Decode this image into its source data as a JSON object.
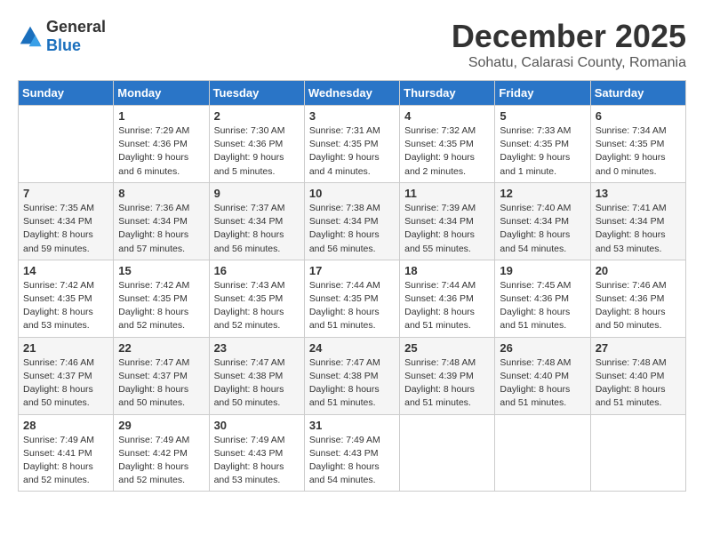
{
  "logo": {
    "general": "General",
    "blue": "Blue"
  },
  "title": {
    "month": "December 2025",
    "subtitle": "Sohatu, Calarasi County, Romania"
  },
  "weekdays": [
    "Sunday",
    "Monday",
    "Tuesday",
    "Wednesday",
    "Thursday",
    "Friday",
    "Saturday"
  ],
  "weeks": [
    [
      {
        "day": null
      },
      {
        "day": 1,
        "sunrise": "7:29 AM",
        "sunset": "4:36 PM",
        "daylight": "9 hours and 6 minutes."
      },
      {
        "day": 2,
        "sunrise": "7:30 AM",
        "sunset": "4:36 PM",
        "daylight": "9 hours and 5 minutes."
      },
      {
        "day": 3,
        "sunrise": "7:31 AM",
        "sunset": "4:35 PM",
        "daylight": "9 hours and 4 minutes."
      },
      {
        "day": 4,
        "sunrise": "7:32 AM",
        "sunset": "4:35 PM",
        "daylight": "9 hours and 2 minutes."
      },
      {
        "day": 5,
        "sunrise": "7:33 AM",
        "sunset": "4:35 PM",
        "daylight": "9 hours and 1 minute."
      },
      {
        "day": 6,
        "sunrise": "7:34 AM",
        "sunset": "4:35 PM",
        "daylight": "9 hours and 0 minutes."
      }
    ],
    [
      {
        "day": 7,
        "sunrise": "7:35 AM",
        "sunset": "4:34 PM",
        "daylight": "8 hours and 59 minutes."
      },
      {
        "day": 8,
        "sunrise": "7:36 AM",
        "sunset": "4:34 PM",
        "daylight": "8 hours and 57 minutes."
      },
      {
        "day": 9,
        "sunrise": "7:37 AM",
        "sunset": "4:34 PM",
        "daylight": "8 hours and 56 minutes."
      },
      {
        "day": 10,
        "sunrise": "7:38 AM",
        "sunset": "4:34 PM",
        "daylight": "8 hours and 56 minutes."
      },
      {
        "day": 11,
        "sunrise": "7:39 AM",
        "sunset": "4:34 PM",
        "daylight": "8 hours and 55 minutes."
      },
      {
        "day": 12,
        "sunrise": "7:40 AM",
        "sunset": "4:34 PM",
        "daylight": "8 hours and 54 minutes."
      },
      {
        "day": 13,
        "sunrise": "7:41 AM",
        "sunset": "4:34 PM",
        "daylight": "8 hours and 53 minutes."
      }
    ],
    [
      {
        "day": 14,
        "sunrise": "7:42 AM",
        "sunset": "4:35 PM",
        "daylight": "8 hours and 53 minutes."
      },
      {
        "day": 15,
        "sunrise": "7:42 AM",
        "sunset": "4:35 PM",
        "daylight": "8 hours and 52 minutes."
      },
      {
        "day": 16,
        "sunrise": "7:43 AM",
        "sunset": "4:35 PM",
        "daylight": "8 hours and 52 minutes."
      },
      {
        "day": 17,
        "sunrise": "7:44 AM",
        "sunset": "4:35 PM",
        "daylight": "8 hours and 51 minutes."
      },
      {
        "day": 18,
        "sunrise": "7:44 AM",
        "sunset": "4:36 PM",
        "daylight": "8 hours and 51 minutes."
      },
      {
        "day": 19,
        "sunrise": "7:45 AM",
        "sunset": "4:36 PM",
        "daylight": "8 hours and 51 minutes."
      },
      {
        "day": 20,
        "sunrise": "7:46 AM",
        "sunset": "4:36 PM",
        "daylight": "8 hours and 50 minutes."
      }
    ],
    [
      {
        "day": 21,
        "sunrise": "7:46 AM",
        "sunset": "4:37 PM",
        "daylight": "8 hours and 50 minutes."
      },
      {
        "day": 22,
        "sunrise": "7:47 AM",
        "sunset": "4:37 PM",
        "daylight": "8 hours and 50 minutes."
      },
      {
        "day": 23,
        "sunrise": "7:47 AM",
        "sunset": "4:38 PM",
        "daylight": "8 hours and 50 minutes."
      },
      {
        "day": 24,
        "sunrise": "7:47 AM",
        "sunset": "4:38 PM",
        "daylight": "8 hours and 51 minutes."
      },
      {
        "day": 25,
        "sunrise": "7:48 AM",
        "sunset": "4:39 PM",
        "daylight": "8 hours and 51 minutes."
      },
      {
        "day": 26,
        "sunrise": "7:48 AM",
        "sunset": "4:40 PM",
        "daylight": "8 hours and 51 minutes."
      },
      {
        "day": 27,
        "sunrise": "7:48 AM",
        "sunset": "4:40 PM",
        "daylight": "8 hours and 51 minutes."
      }
    ],
    [
      {
        "day": 28,
        "sunrise": "7:49 AM",
        "sunset": "4:41 PM",
        "daylight": "8 hours and 52 minutes."
      },
      {
        "day": 29,
        "sunrise": "7:49 AM",
        "sunset": "4:42 PM",
        "daylight": "8 hours and 52 minutes."
      },
      {
        "day": 30,
        "sunrise": "7:49 AM",
        "sunset": "4:43 PM",
        "daylight": "8 hours and 53 minutes."
      },
      {
        "day": 31,
        "sunrise": "7:49 AM",
        "sunset": "4:43 PM",
        "daylight": "8 hours and 54 minutes."
      },
      {
        "day": null
      },
      {
        "day": null
      },
      {
        "day": null
      }
    ]
  ]
}
